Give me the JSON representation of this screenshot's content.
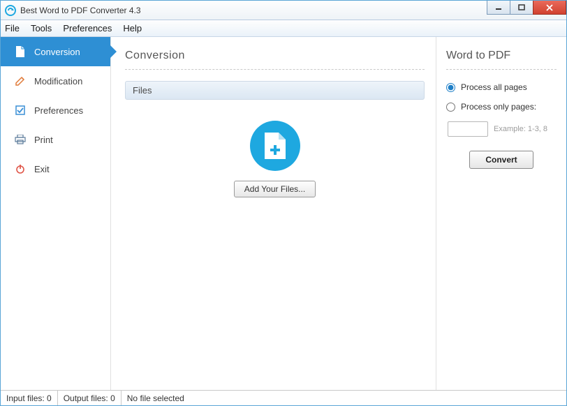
{
  "window": {
    "title": "Best Word to PDF Converter 4.3"
  },
  "menu": [
    "File",
    "Tools",
    "Preferences",
    "Help"
  ],
  "sidebar": {
    "items": [
      {
        "label": "Conversion"
      },
      {
        "label": "Modification"
      },
      {
        "label": "Preferences"
      },
      {
        "label": "Print"
      },
      {
        "label": "Exit"
      }
    ]
  },
  "center": {
    "heading": "Conversion",
    "files_header": "Files",
    "add_button": "Add Your Files..."
  },
  "right": {
    "heading": "Word to PDF",
    "radio_all": "Process all pages",
    "radio_only": "Process only pages:",
    "pages_value": "",
    "example": "Example: 1-3, 8",
    "convert": "Convert"
  },
  "status": {
    "input": "Input files: 0",
    "output": "Output files: 0",
    "selection": "No file selected"
  }
}
